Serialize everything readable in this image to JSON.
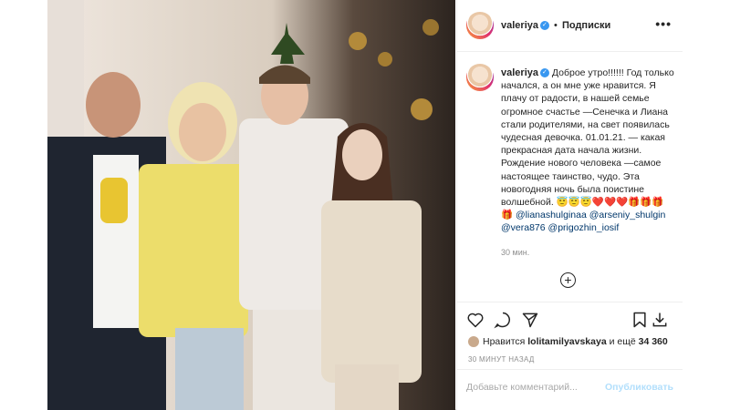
{
  "post": {
    "username": "valeriya",
    "separator": "•",
    "follow_label": "Подписки",
    "more_icon": "more-dots-icon",
    "caption_pre": "Доброе утро!!!!!! Год только начался, а он мне уже нравится. Я плачу от радости, в нашей семье огромное счастье —Сенечка и Лиана стали родителями, на свет появилась чудесная девочка. 01.01.21. — какая прекрасная дата начала жизни. Рождение нового человека —самое настоящее таинство, чудо. Эта новогодняя ночь была поистине волшебной.",
    "caption_emojis": "😇😇😇❤️❤️❤️🎁🎁🎁",
    "mentions": [
      "@lianashulginaa",
      "@arseniy_shulgin",
      "@vera876",
      "@prigozhin_iosif"
    ],
    "caption_time": "30 мин.",
    "liked_by_prefix": "Нравится",
    "liked_by_user": "lolitamilyavskaya",
    "liked_by_middle": "и ещё",
    "likes_count": "34 360",
    "time_ago": "30 МИНУТ НАЗАД",
    "comment_placeholder": "Добавьте комментарий...",
    "publish_label": "Опубликовать"
  },
  "colors": {
    "link": "#00376b",
    "verified": "#3897f0",
    "publish_disabled": "#b2dffc"
  }
}
